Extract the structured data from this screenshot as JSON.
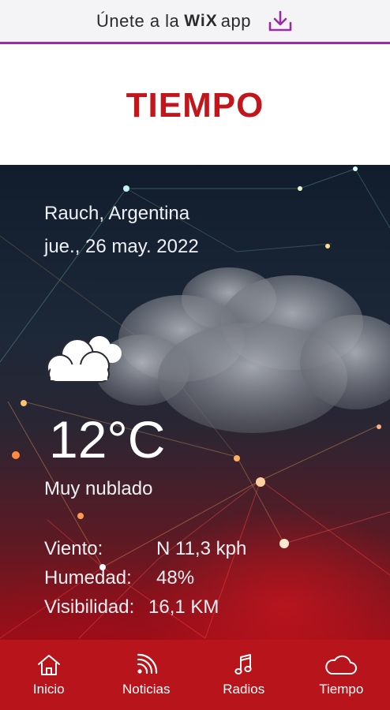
{
  "banner": {
    "text_prefix": "Únete a la",
    "brand": "WiX",
    "text_suffix": "app",
    "icon": "download-icon"
  },
  "header": {
    "title": "TIEMPO"
  },
  "weather": {
    "location": "Rauch, Argentina",
    "date": "jue., 26 may. 2022",
    "icon": "partly-cloudy-icon",
    "temperature": "12°C",
    "condition": "Muy nublado",
    "details": {
      "wind_label": "Viento:",
      "wind_value": "N 11,3 kph",
      "humidity_label": "Humedad:",
      "humidity_value": "48%",
      "visibility_label": "Visibilidad:",
      "visibility_value": "16,1 KM"
    }
  },
  "nav": {
    "items": [
      {
        "label": "Inicio",
        "icon": "home-icon"
      },
      {
        "label": "Noticias",
        "icon": "rss-icon"
      },
      {
        "label": "Radios",
        "icon": "music-note-icon"
      },
      {
        "label": "Tiempo",
        "icon": "cloud-icon"
      }
    ]
  },
  "colors": {
    "accent": "#c2161c",
    "nav_bg": "#b7141b",
    "banner_border": "#9b2aa8"
  }
}
